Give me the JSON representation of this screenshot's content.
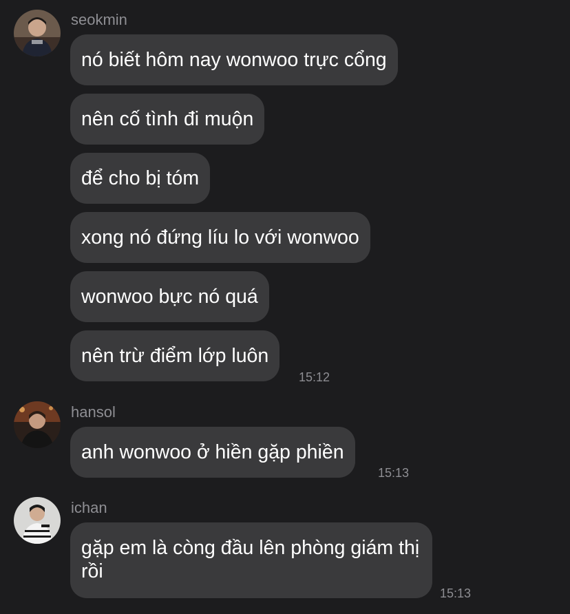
{
  "conversation": {
    "groups": [
      {
        "sender": "seokmin",
        "avatar_icon": "user-photo-avatar",
        "messages": [
          "nó biết hôm nay wonwoo trực cổng",
          "nên cố tình đi muộn",
          "để cho bị tóm",
          "xong nó đứng líu lo với wonwoo",
          "wonwoo bực nó quá",
          "nên trừ điểm lớp luôn"
        ],
        "time": "15:12"
      },
      {
        "sender": "hansol",
        "avatar_icon": "user-photo-avatar",
        "messages": [
          "anh wonwoo ở hiền gặp phiền"
        ],
        "time": "15:13"
      },
      {
        "sender": "ichan",
        "avatar_icon": "user-photo-avatar",
        "messages": [
          "gặp em là còng đầu lên phòng giám thị rồi"
        ],
        "time": "15:13"
      }
    ]
  },
  "colors": {
    "background": "#1c1c1e",
    "bubble": "#3a3a3c",
    "text": "#ffffff",
    "meta": "#8e8e93"
  }
}
